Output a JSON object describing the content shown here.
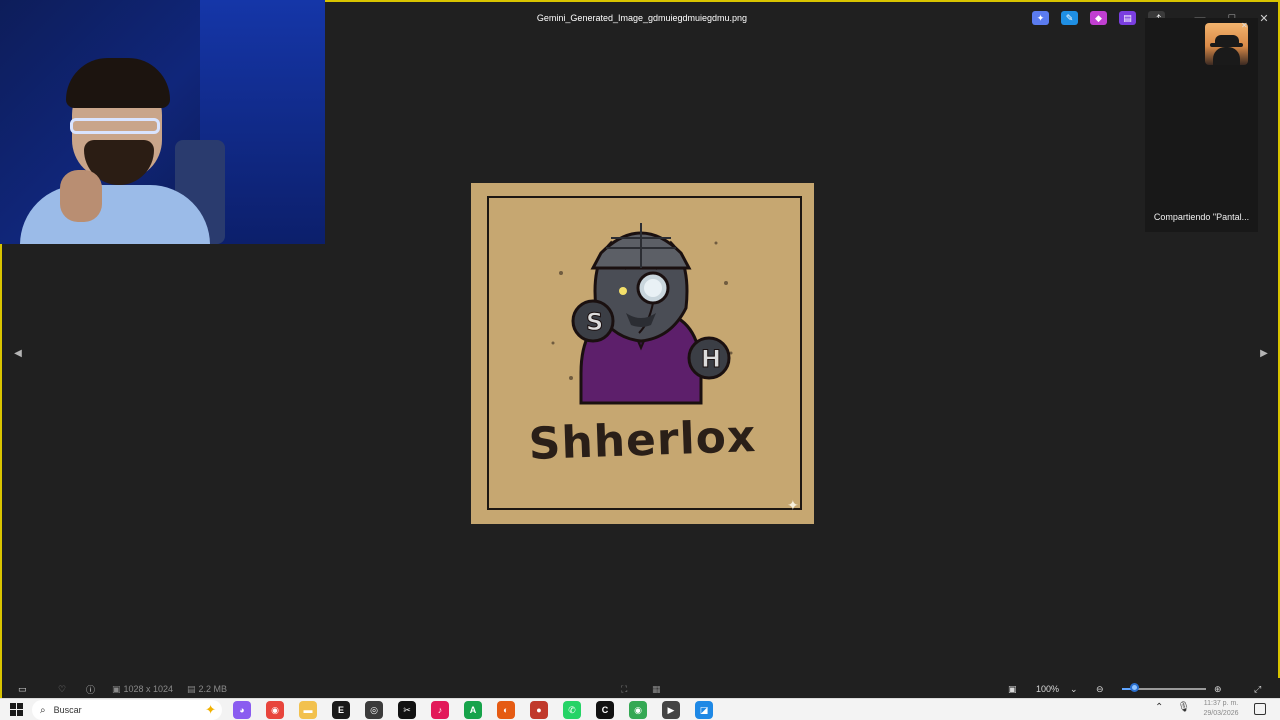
{
  "window": {
    "title": "Gemini_Generated_Image_gdmuiegdmuiegdmu.png"
  },
  "titlebar_icons": [
    {
      "name": "copilot-icon",
      "color": "#5b7cf0"
    },
    {
      "name": "edit-icon",
      "color": "#1f8fe3"
    },
    {
      "name": "designer-icon",
      "color": "#c13fd1"
    },
    {
      "name": "clipchamp-icon",
      "color": "#7a3ee0"
    },
    {
      "name": "share-icon",
      "color": "#3a3a3a"
    }
  ],
  "screen_share": {
    "label": "Compartiendo \"Pantal..."
  },
  "image": {
    "logo_text": "Shherlox",
    "accent_purple": "#5d1f6b",
    "background": "#c6a771"
  },
  "bottom_bar": {
    "dimensions": "1028 x 1024",
    "file_size": "2.2 MB",
    "zoom": "100%"
  },
  "taskbar": {
    "search_placeholder": "Buscar",
    "apps": [
      {
        "name": "copilot-app-icon",
        "color": "#8a5cf0",
        "glyph": "◕"
      },
      {
        "name": "chrome-icon",
        "color": "#e8453c",
        "glyph": "◉"
      },
      {
        "name": "file-explorer-icon",
        "color": "#f2c14e",
        "glyph": "▬"
      },
      {
        "name": "epic-games-icon",
        "color": "#1a1a1a",
        "glyph": "E"
      },
      {
        "name": "obs-icon",
        "color": "#3b3b3b",
        "glyph": "◎"
      },
      {
        "name": "capcut-icon",
        "color": "#111111",
        "glyph": "✂"
      },
      {
        "name": "tiktok-icon",
        "color": "#e21a5a",
        "glyph": "♪"
      },
      {
        "name": "evernote-icon",
        "color": "#16a34a",
        "glyph": "A"
      },
      {
        "name": "firefox-icon",
        "color": "#e55b13",
        "glyph": "◐"
      },
      {
        "name": "davinci-icon",
        "color": "#c0392b",
        "glyph": "●"
      },
      {
        "name": "whatsapp-icon",
        "color": "#25d366",
        "glyph": "✆"
      },
      {
        "name": "capcut-alt-icon",
        "color": "#111111",
        "glyph": "C"
      },
      {
        "name": "chrome-alt-icon",
        "color": "#34a853",
        "glyph": "◉"
      },
      {
        "name": "media-player-icon",
        "color": "#444444",
        "glyph": "▶"
      },
      {
        "name": "photos-icon",
        "color": "#1e88e5",
        "glyph": "◪"
      }
    ],
    "time": "11:37 p. m.",
    "date": "29/03/2026"
  }
}
